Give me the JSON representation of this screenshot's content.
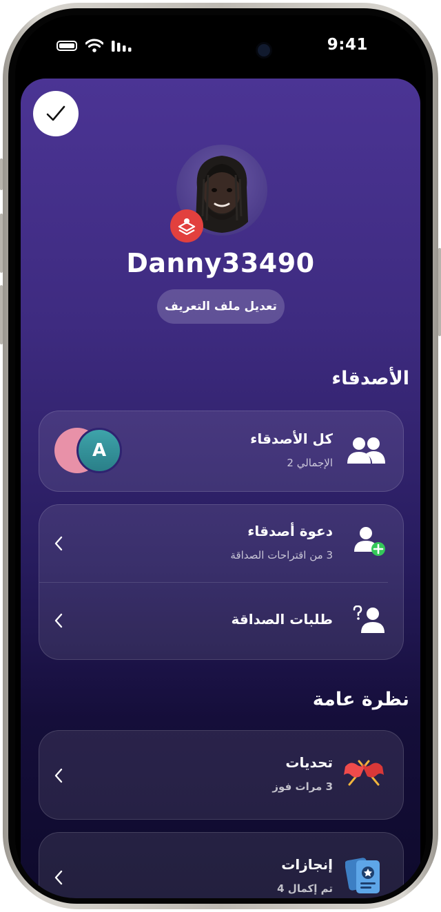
{
  "status_bar": {
    "time": "9:41"
  },
  "profile": {
    "username": "Danny33490",
    "edit_label": "تعديل ملف التعريف"
  },
  "friends": {
    "section_title": "الأصدقاء",
    "all_friends": {
      "title": "كل الأصدقاء",
      "subtitle": "الإجمالي 2",
      "avatar_letter": "A"
    },
    "invite": {
      "title": "دعوة أصدقاء",
      "subtitle": "3 من اقتراحات الصداقة"
    },
    "requests": {
      "title": "طلبات الصداقة"
    }
  },
  "overview": {
    "section_title": "نظرة عامة",
    "challenges": {
      "title": "تحديات",
      "subtitle": "3 مرات فوز"
    },
    "achievements": {
      "title": "إنجازات",
      "subtitle": "تم إكمال 4"
    }
  },
  "colors": {
    "accent_green": "#34c759",
    "badge_red": "#e2403e",
    "bg_top": "#4b3494",
    "bg_bottom": "#0e0a2c"
  },
  "icons": [
    "checkmark-icon",
    "game-center-icon",
    "friends-icon",
    "add-friend-icon",
    "friend-request-icon",
    "flags-icon",
    "achievement-cards-icon",
    "chevron-left-icon"
  ]
}
